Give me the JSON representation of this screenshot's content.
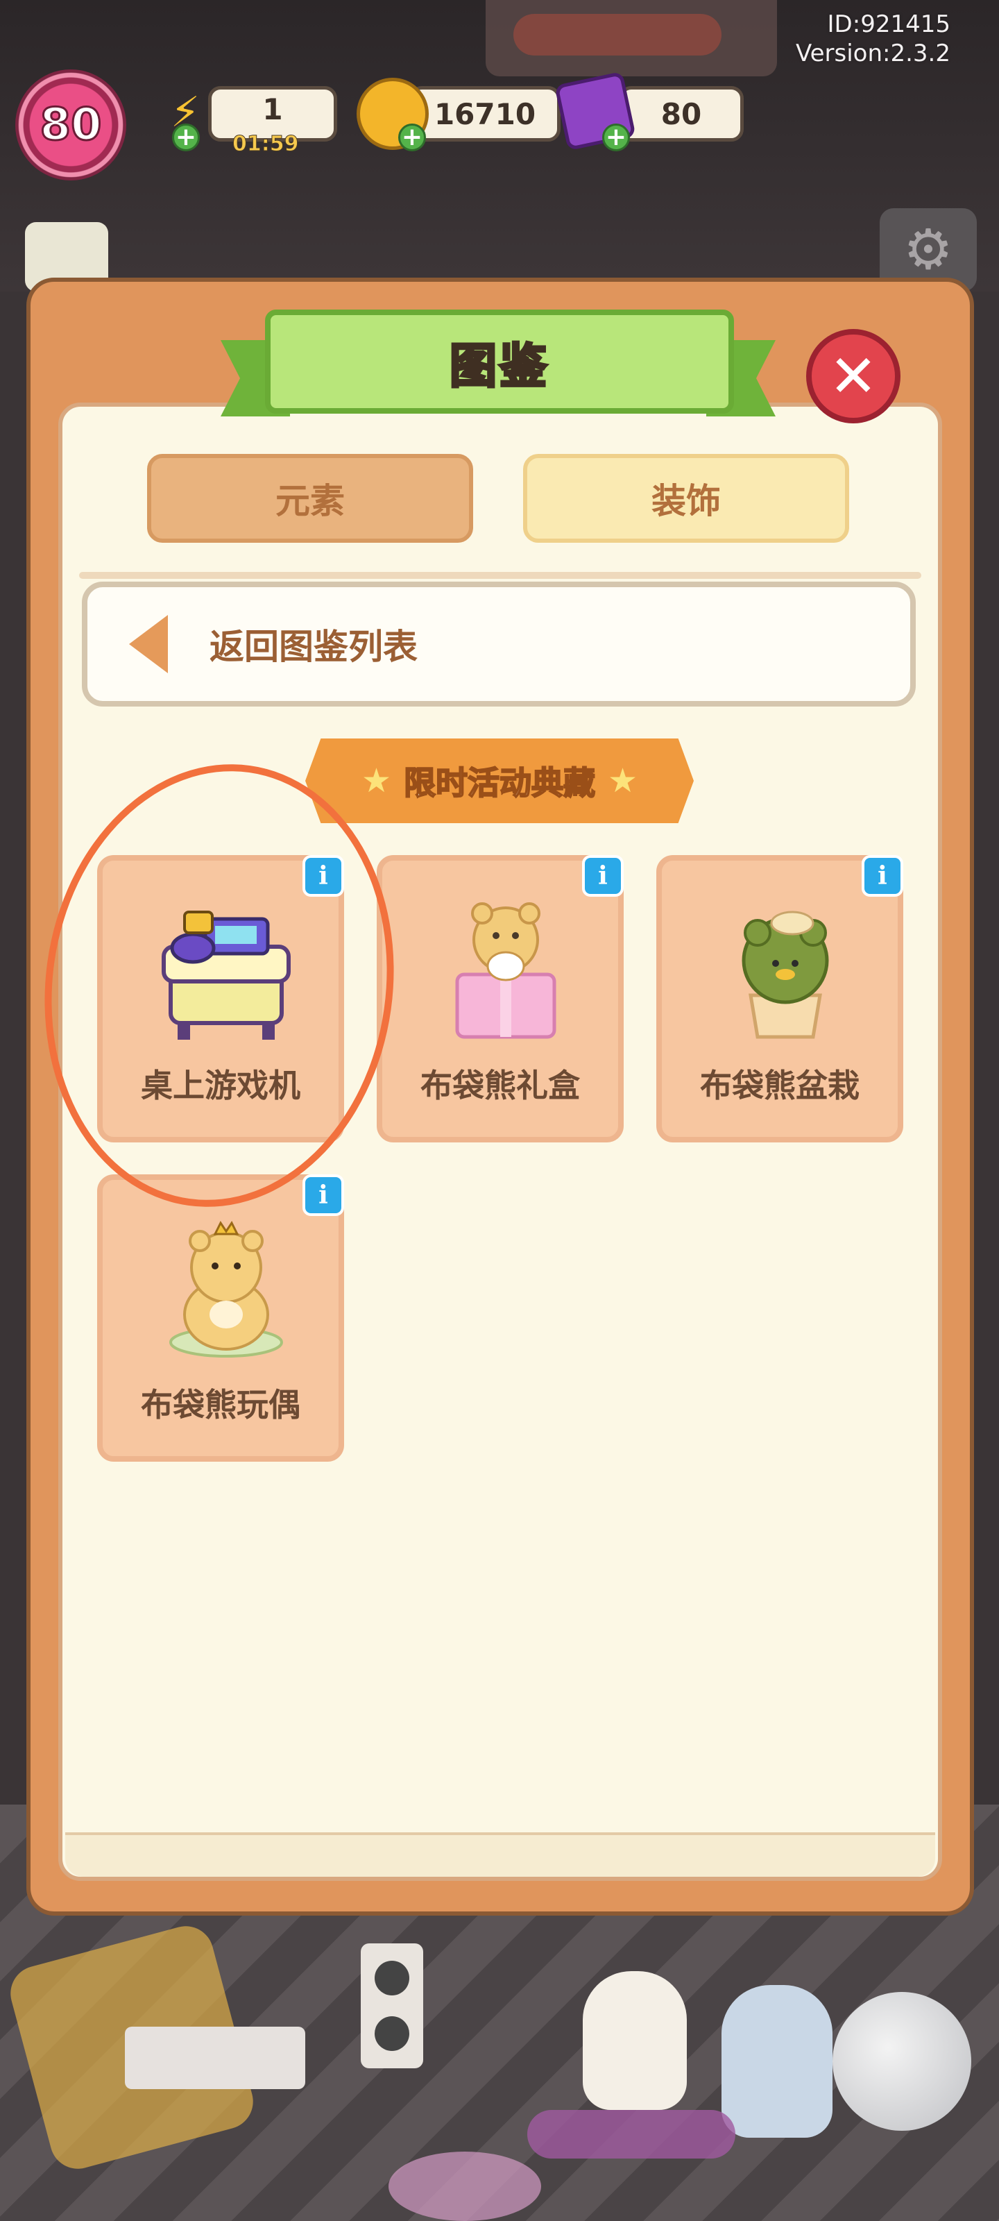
{
  "hud": {
    "id_text": "ID:921415",
    "version_text": "Version:2.3.2",
    "level": "80",
    "energy": "1",
    "energy_timer": "01:59",
    "coins": "16710",
    "gems": "80"
  },
  "modal": {
    "title": "图鉴",
    "tabs": [
      {
        "label": "元素"
      },
      {
        "label": "装饰"
      }
    ],
    "back_label": "返回图鉴列表",
    "section_title": "限时活动典藏",
    "items": [
      {
        "name": "桌上游戏机",
        "icon": "tabletop-game-console-icon"
      },
      {
        "name": "布袋熊礼盒",
        "icon": "bear-gift-box-icon"
      },
      {
        "name": "布袋熊盆栽",
        "icon": "bear-bonsai-icon"
      },
      {
        "name": "布袋熊玩偶",
        "icon": "bear-plush-icon"
      }
    ]
  },
  "colors": {
    "panel": "#e0955c",
    "panel_inner": "#fcf8e5",
    "card": "#f7c6a0",
    "title_green": "#b8e67a",
    "close_red": "#e2444d",
    "annotation": "#f2713d"
  }
}
